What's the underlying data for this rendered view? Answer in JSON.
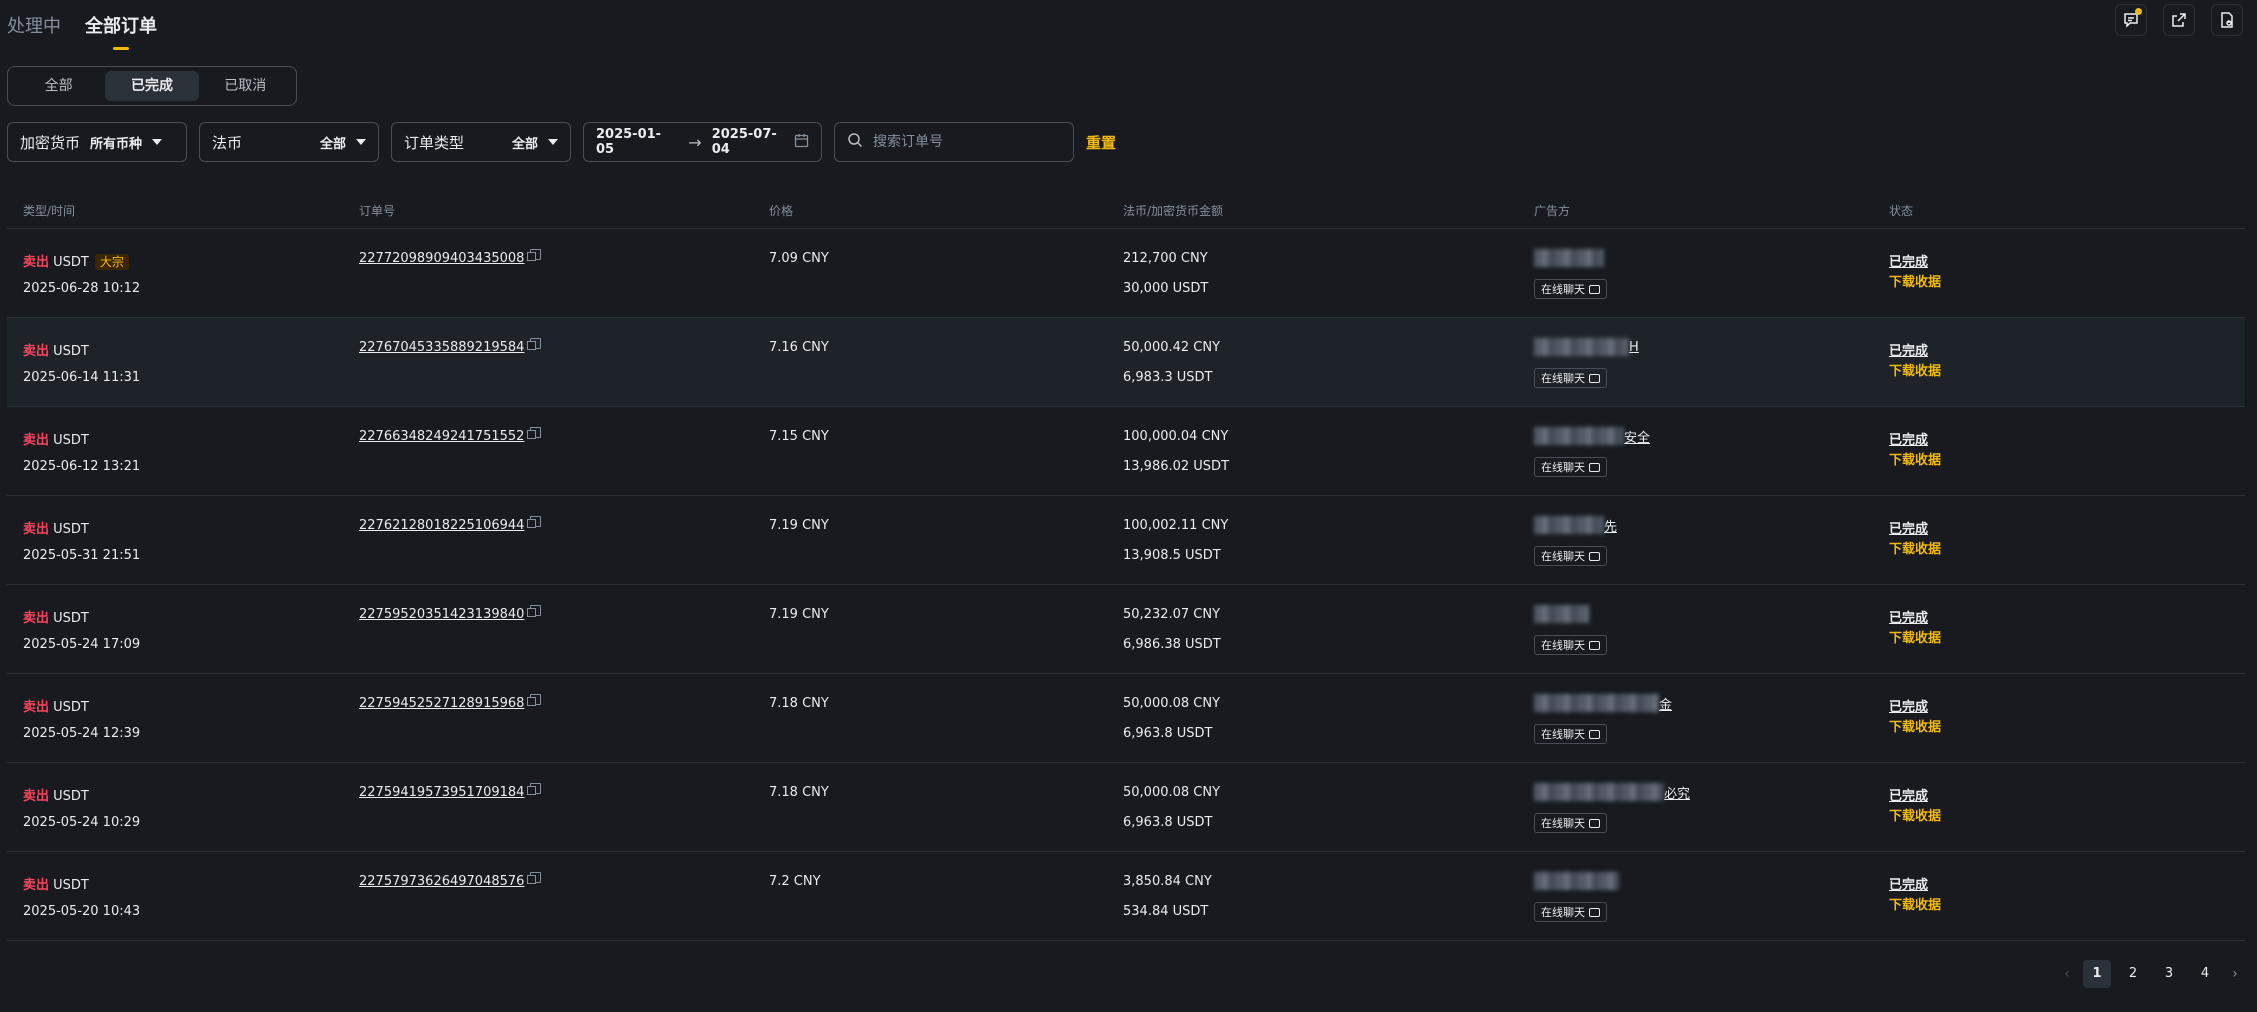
{
  "top_tabs": [
    {
      "label": "处理中",
      "active": false
    },
    {
      "label": "全部订单",
      "active": true
    }
  ],
  "top_icons": [
    "chat-icon",
    "export-icon",
    "report-icon"
  ],
  "status_segments": [
    {
      "label": "全部",
      "active": false
    },
    {
      "label": "已完成",
      "active": true
    },
    {
      "label": "已取消",
      "active": false
    }
  ],
  "filters": {
    "crypto": {
      "label": "加密货币",
      "value": "所有币种"
    },
    "fiat": {
      "label": "法币",
      "value": "全部"
    },
    "order_type": {
      "label": "订单类型",
      "value": "全部"
    },
    "date_from": "2025-01-05",
    "date_to": "2025-07-04",
    "search_placeholder": "搜索订单号",
    "reset_label": "重置"
  },
  "columns": [
    "类型/时间",
    "订单号",
    "价格",
    "法币/加密货币金额",
    "广告方",
    "状态"
  ],
  "rows": [
    {
      "side": "卖出",
      "asset": "USDT",
      "badge": "大宗",
      "time": "2025-06-28 10:12",
      "order_no": "22772098909403435008",
      "price": "7.09 CNY",
      "fiat_amount": "212,700 CNY",
      "crypto_amount": "30,000 USDT",
      "advertiser": "",
      "chat": "在线聊天",
      "status": "已完成",
      "receipt": "下载收据"
    },
    {
      "side": "卖出",
      "asset": "USDT",
      "badge": "",
      "time": "2025-06-14 11:31",
      "order_no": "22767045335889219584",
      "price": "7.16 CNY",
      "fiat_amount": "50,000.42 CNY",
      "crypto_amount": "6,983.3 USDT",
      "advertiser": "H",
      "chat": "在线聊天",
      "status": "已完成",
      "receipt": "下载收据"
    },
    {
      "side": "卖出",
      "asset": "USDT",
      "badge": "",
      "time": "2025-06-12 13:21",
      "order_no": "22766348249241751552",
      "price": "7.15 CNY",
      "fiat_amount": "100,000.04 CNY",
      "crypto_amount": "13,986.02 USDT",
      "advertiser": "安全",
      "chat": "在线聊天",
      "status": "已完成",
      "receipt": "下载收据"
    },
    {
      "side": "卖出",
      "asset": "USDT",
      "badge": "",
      "time": "2025-05-31 21:51",
      "order_no": "22762128018225106944",
      "price": "7.19 CNY",
      "fiat_amount": "100,002.11 CNY",
      "crypto_amount": "13,908.5 USDT",
      "advertiser": "先",
      "chat": "在线聊天",
      "status": "已完成",
      "receipt": "下载收据"
    },
    {
      "side": "卖出",
      "asset": "USDT",
      "badge": "",
      "time": "2025-05-24 17:09",
      "order_no": "22759520351423139840",
      "price": "7.19 CNY",
      "fiat_amount": "50,232.07 CNY",
      "crypto_amount": "6,986.38 USDT",
      "advertiser": "",
      "chat": "在线聊天",
      "status": "已完成",
      "receipt": "下载收据"
    },
    {
      "side": "卖出",
      "asset": "USDT",
      "badge": "",
      "time": "2025-05-24 12:39",
      "order_no": "22759452527128915968",
      "price": "7.18 CNY",
      "fiat_amount": "50,000.08 CNY",
      "crypto_amount": "6,963.8 USDT",
      "advertiser": "金",
      "chat": "在线聊天",
      "status": "已完成",
      "receipt": "下载收据"
    },
    {
      "side": "卖出",
      "asset": "USDT",
      "badge": "",
      "time": "2025-05-24 10:29",
      "order_no": "22759419573951709184",
      "price": "7.18 CNY",
      "fiat_amount": "50,000.08 CNY",
      "crypto_amount": "6,963.8 USDT",
      "advertiser": "必究",
      "chat": "在线聊天",
      "status": "已完成",
      "receipt": "下载收据"
    },
    {
      "side": "卖出",
      "asset": "USDT",
      "badge": "",
      "time": "2025-05-20 10:43",
      "order_no": "22757973626497048576",
      "price": "7.2 CNY",
      "fiat_amount": "3,850.84 CNY",
      "crypto_amount": "534.84 USDT",
      "advertiser": "",
      "chat": "在线聊天",
      "status": "已完成",
      "receipt": "下载收据"
    }
  ],
  "pagination": {
    "pages": [
      "1",
      "2",
      "3",
      "4"
    ],
    "current": "1",
    "prev": "‹",
    "next": "›"
  },
  "colors": {
    "accent": "#f0b90b",
    "sell": "#f6465d",
    "background": "#181a20"
  }
}
